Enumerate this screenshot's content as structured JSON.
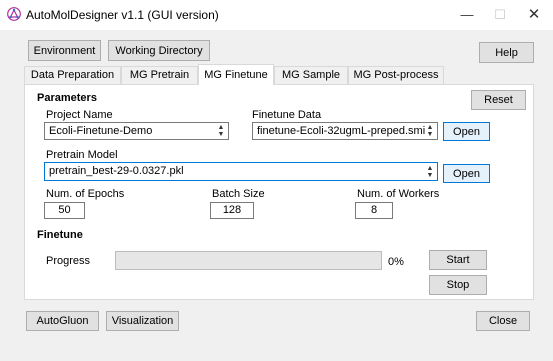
{
  "window": {
    "title": "AutoMolDesigner v1.1 (GUI version)",
    "min_glyph": "—",
    "max_glyph": "☐",
    "close_glyph": "✕"
  },
  "toolbar": {
    "environment": "Environment",
    "working_directory": "Working Directory",
    "help": "Help"
  },
  "tabs": [
    {
      "label": "Data Preparation",
      "active": false
    },
    {
      "label": "MG Pretrain",
      "active": false
    },
    {
      "label": "MG Finetune",
      "active": true
    },
    {
      "label": "MG Sample",
      "active": false
    },
    {
      "label": "MG Post-process",
      "active": false
    }
  ],
  "parameters": {
    "heading": "Parameters",
    "reset": "Reset",
    "project_name_label": "Project Name",
    "project_name_value": "Ecoli-Finetune-Demo",
    "finetune_data_label": "Finetune Data",
    "finetune_data_value": "finetune-Ecoli-32ugmL-preped.smi",
    "pretrain_model_label": "Pretrain Model",
    "pretrain_model_value": "pretrain_best-29-0.0327.pkl",
    "open": "Open",
    "epochs_label": "Num. of Epochs",
    "epochs_value": "50",
    "batch_label": "Batch Size",
    "batch_value": "128",
    "workers_label": "Num. of Workers",
    "workers_value": "8"
  },
  "finetune": {
    "heading": "Finetune",
    "progress_label": "Progress",
    "progress_fraction": 0,
    "progress_text": "0%",
    "start": "Start",
    "stop": "Stop"
  },
  "footer": {
    "autogluon": "AutoGluon",
    "visualization": "Visualization",
    "close": "Close"
  },
  "colors": {
    "accent": "#0078d7",
    "progress_fill": "#06b025",
    "app_icon": "#b0309a"
  },
  "icons": {
    "app": "molecule-app-icon",
    "spin": "spin-up-down-icon"
  }
}
